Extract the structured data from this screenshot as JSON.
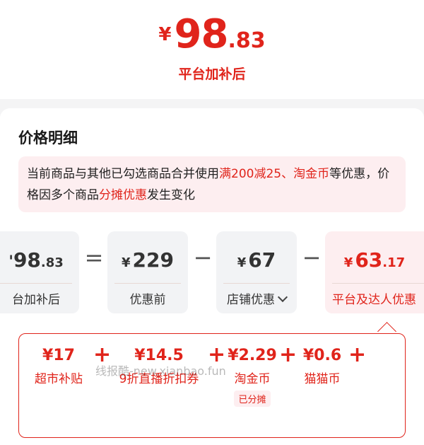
{
  "header": {
    "currency": "¥",
    "price_int": "98",
    "price_dec": ".83",
    "caption": "平台加补后"
  },
  "details": {
    "title": "价格明细",
    "notice": {
      "part1": "当前商品与其他已勾选商品合并使用",
      "hl1": "满200减25、淘金币",
      "part2": "等优惠，价格因多个商品",
      "hl2": "分摊优惠",
      "part3": "发生变化"
    }
  },
  "formula": {
    "final": {
      "val_int": "98",
      "val_dec": ".83",
      "label": "台加补后"
    },
    "eq": "=",
    "original": {
      "sym": "¥",
      "val": "229",
      "label": "优惠前"
    },
    "minus1": "−",
    "store": {
      "sym": "¥",
      "val": "67",
      "label": "店铺优惠"
    },
    "minus2": "−",
    "platform": {
      "sym": "¥",
      "val_int": "63",
      "val_dec": ".17",
      "label": "平台及达人优惠"
    }
  },
  "breakdown": {
    "items": [
      {
        "amount": "¥17",
        "name": "超市补贴"
      },
      {
        "amount": "¥14.5",
        "name": "9折直播折扣券"
      },
      {
        "amount": "¥2.29",
        "name": "淘金币",
        "tag": "已分摊"
      },
      {
        "amount": "¥0.6",
        "name": "猫猫币"
      }
    ],
    "plus": "+"
  },
  "watermark": "线报酷-new.xianbao.fun",
  "colors": {
    "accent": "#e0241b",
    "pink_bg": "#fdeef0",
    "gray_box": "#f2f3f5"
  }
}
